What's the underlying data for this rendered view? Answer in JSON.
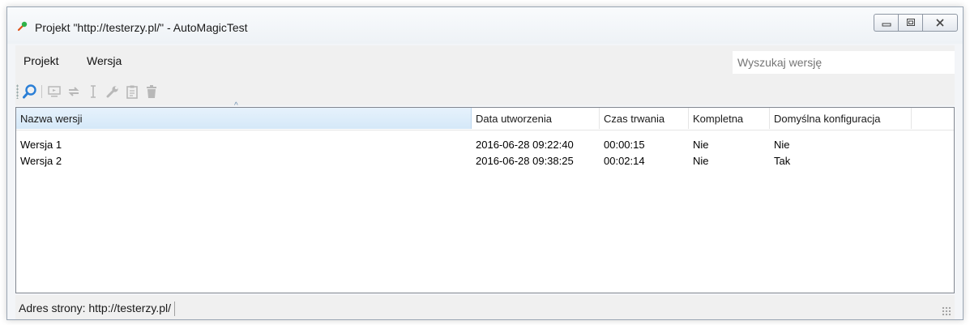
{
  "window": {
    "title": "Projekt \"http://testerzy.pl/\" - AutoMagicTest",
    "controls": {
      "minimize": "minimize-icon",
      "maximize": "maximize-icon",
      "close": "close-icon"
    }
  },
  "menu": {
    "items": [
      "Projekt",
      "Wersja"
    ],
    "search_placeholder": "Wyszukaj wersję"
  },
  "toolbar": {
    "icons": [
      "search-icon",
      "monitor-icon",
      "swap-icon",
      "text-cursor-icon",
      "wrench-icon",
      "clipboard-icon",
      "trash-icon"
    ]
  },
  "table": {
    "columns": [
      "Nazwa wersji",
      "Data utworzenia",
      "Czas trwania",
      "Kompletna",
      "Domyślna konfiguracja"
    ],
    "sorted_column": "Nazwa wersji",
    "rows": [
      [
        "Wersja 1",
        "2016-06-28 09:22:40",
        "00:00:15",
        "Nie",
        "Nie"
      ],
      [
        "Wersja 2",
        "2016-06-28 09:38:25",
        "00:02:14",
        "Nie",
        "Tak"
      ]
    ]
  },
  "status": {
    "text": "Adres strony: http://testerzy.pl/"
  }
}
